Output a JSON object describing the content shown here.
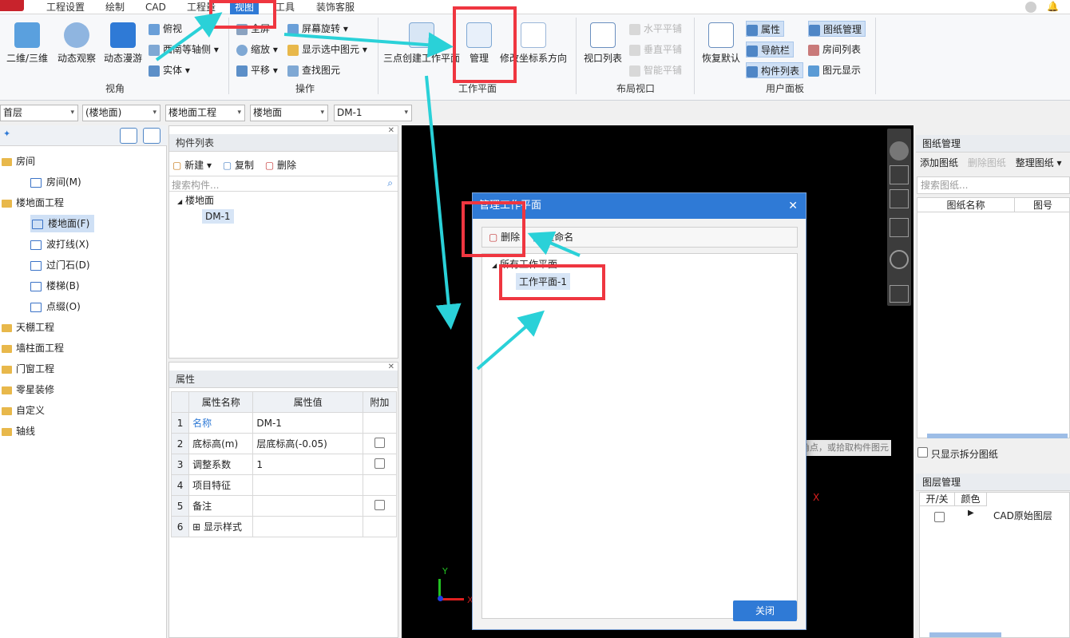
{
  "menubar": {
    "items": [
      "工程设置",
      "绘制",
      "CAD",
      "工程量",
      "视图",
      "工具",
      "装饰客服"
    ],
    "active_index": 4
  },
  "ribbon": {
    "view_group": {
      "label": "视角",
      "buttons": [
        "二维/三维",
        "动态观察",
        "动态漫游"
      ],
      "small": [
        "俯视",
        "西南等轴侧",
        "实体"
      ]
    },
    "ops_group": {
      "label": "操作",
      "small": [
        "全屏",
        "缩放",
        "平移",
        "屏幕旋转",
        "显示选中图元",
        "查找图元"
      ]
    },
    "workplane_group": {
      "label": "工作平面",
      "buttons": [
        "三点创建工作平面",
        "管理",
        "修改坐标系方向"
      ]
    },
    "layout_group": {
      "label": "布局视口",
      "buttons": [
        "视口列表"
      ],
      "small": [
        "水平平铺",
        "垂直平铺",
        "智能平铺"
      ]
    },
    "user_group": {
      "label": "用户面板",
      "buttons": [
        "恢复默认"
      ],
      "small": [
        "属性",
        "导航栏",
        "构件列表",
        "图纸管理",
        "房间列表",
        "图元显示"
      ]
    }
  },
  "selectors": [
    "首层",
    "(楼地面)",
    "楼地面工程",
    "楼地面",
    "DM-1"
  ],
  "left_tree": {
    "items": [
      {
        "label": "房间",
        "level": 0
      },
      {
        "label": "房间(M)",
        "level": 1
      },
      {
        "label": "楼地面工程",
        "level": 0
      },
      {
        "label": "楼地面(F)",
        "level": 1,
        "selected": true
      },
      {
        "label": "波打线(X)",
        "level": 1
      },
      {
        "label": "过门石(D)",
        "level": 1
      },
      {
        "label": "楼梯(B)",
        "level": 1
      },
      {
        "label": "点缀(O)",
        "level": 1
      },
      {
        "label": "天棚工程",
        "level": 0
      },
      {
        "label": "墙柱面工程",
        "level": 0
      },
      {
        "label": "门窗工程",
        "level": 0
      },
      {
        "label": "零星装修",
        "level": 0
      },
      {
        "label": "自定义",
        "level": 0
      },
      {
        "label": "轴线",
        "level": 0
      }
    ]
  },
  "component_list": {
    "title": "构件列表",
    "toolbar": {
      "new": "新建",
      "copy": "复制",
      "delete": "删除"
    },
    "search_placeholder": "搜索构件...",
    "tree_root": "楼地面",
    "tree_child": "DM-1"
  },
  "properties": {
    "title": "属性",
    "headers": [
      "属性名称",
      "属性值",
      "附加"
    ],
    "rows": [
      {
        "n": "1",
        "name": "名称",
        "value": "DM-1",
        "check": false
      },
      {
        "n": "2",
        "name": "底标高(m)",
        "value": "层底标高(-0.05)",
        "check": true
      },
      {
        "n": "3",
        "name": "调整系数",
        "value": "1",
        "check": true
      },
      {
        "n": "4",
        "name": "项目特征",
        "value": "",
        "check": false
      },
      {
        "n": "5",
        "name": "备注",
        "value": "",
        "check": true
      },
      {
        "n": "6",
        "name": "显示样式",
        "value": "",
        "check": false
      }
    ]
  },
  "dialog": {
    "title": "管理工作平面",
    "delete": "删除",
    "rename": "重命名",
    "root": "所有工作平面",
    "item": "工作平面-1",
    "close": "关闭"
  },
  "canvas": {
    "hint": "角点，或拾取构件图元",
    "x_mark": "X",
    "axis_y": "Y",
    "axis_x": "X"
  },
  "drawing_panel": {
    "title": "图纸管理",
    "add": "添加图纸",
    "delete": "删除图纸",
    "organize": "整理图纸",
    "search_placeholder": "搜索图纸...",
    "col_name": "图纸名称",
    "col_num": "图号",
    "only_split": "只显示拆分图纸"
  },
  "layer_panel": {
    "title": "图层管理",
    "col_toggle": "开/关",
    "col_color": "颜色",
    "row": "CAD原始图层"
  },
  "colors": {
    "accent": "#2f7ad6",
    "annotation_red": "#ef3640",
    "annotation_arrow": "#2ad1d8"
  }
}
